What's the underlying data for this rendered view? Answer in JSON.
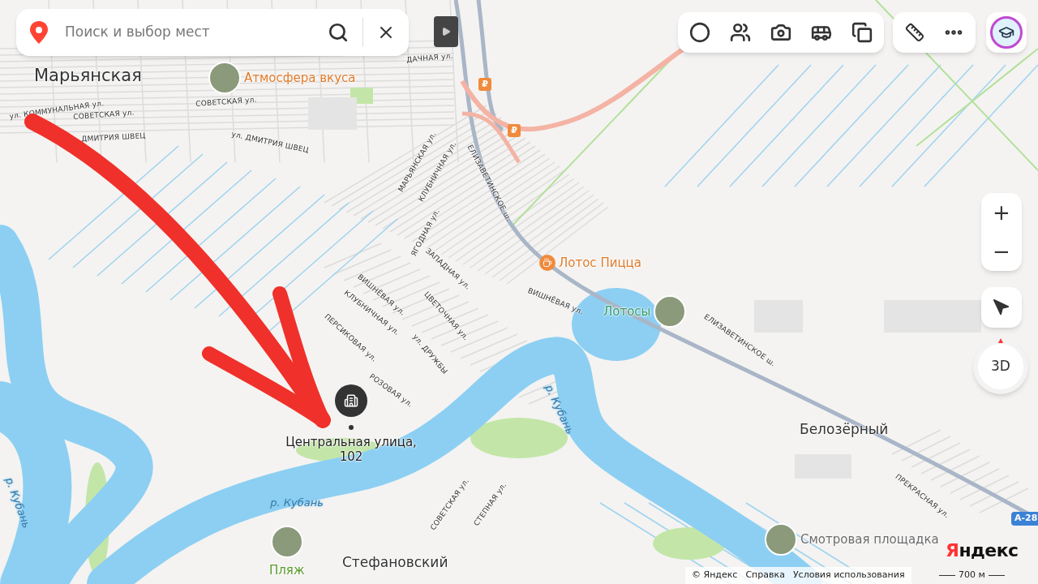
{
  "search": {
    "placeholder": "Поиск и выбор мест"
  },
  "settlements": [
    "Марьянская",
    "Стефановский",
    "Белозёрный"
  ],
  "streets": [
    "ул. КОММУНАЛЬНАЯ ул.",
    "СОВЕТСКАЯ ул.",
    "СОВЕТСКАЯ ул.",
    "ДМИТРИЯ ШВЕЦ",
    "ул. ДМИТРИЯ ШВЕЦ",
    "ДАЧНАЯ ул.",
    "МАРЬЯНСКАЯ ул.",
    "КЛУБНИЧНАЯ ул.",
    "ЕЛИЗАВЕТИНСКОЕ ш.",
    "ЯГОДНАЯ ул.",
    "ЗАПАДНАЯ ул.",
    "ВИШНЁВАЯ ул.",
    "ЦВЕТОЧНАЯ ул.",
    "ВИШНЁВАЯ ул.",
    "КЛУБНИЧНАЯ ул.",
    "ПЕРСИКОВАЯ ул.",
    "ул. ДРУЖБЫ",
    "РОЗОВАЯ ул.",
    "ЕЛИЗАВЕТИНСКОЕ ш.",
    "СОВЕТСКАЯ ул.",
    "СТЕПНАЯ ул.",
    "ПРЕКРАСНАЯ ул."
  ],
  "rivers": [
    "р. Кубань",
    "р. Кубань",
    "р. Кубань"
  ],
  "road_number": "А-28",
  "fuel_markers": [
    "₽",
    "₽"
  ],
  "pois": [
    {
      "name": "Атмосфера вкуса",
      "kind": "photo",
      "color": "#e07b2b"
    },
    {
      "name": "Лотос Пицца",
      "kind": "cafe",
      "color": "#e07b2b"
    },
    {
      "name": "Лотосы",
      "kind": "photo",
      "color": "#2f9a6c"
    },
    {
      "name": "Пляж",
      "kind": "photo",
      "color": "#5a9a2a"
    },
    {
      "name": "Смотровая площадка",
      "kind": "photo",
      "color": "#6b6b6b"
    }
  ],
  "address": "Центральная улица, 102",
  "zoom": {
    "plus": "+",
    "minus": "−"
  },
  "view_3d": "3D",
  "logo": "Яндекс",
  "footer": [
    "© Яндекс",
    "Справка",
    "Условия использования"
  ],
  "scale": "700 м"
}
